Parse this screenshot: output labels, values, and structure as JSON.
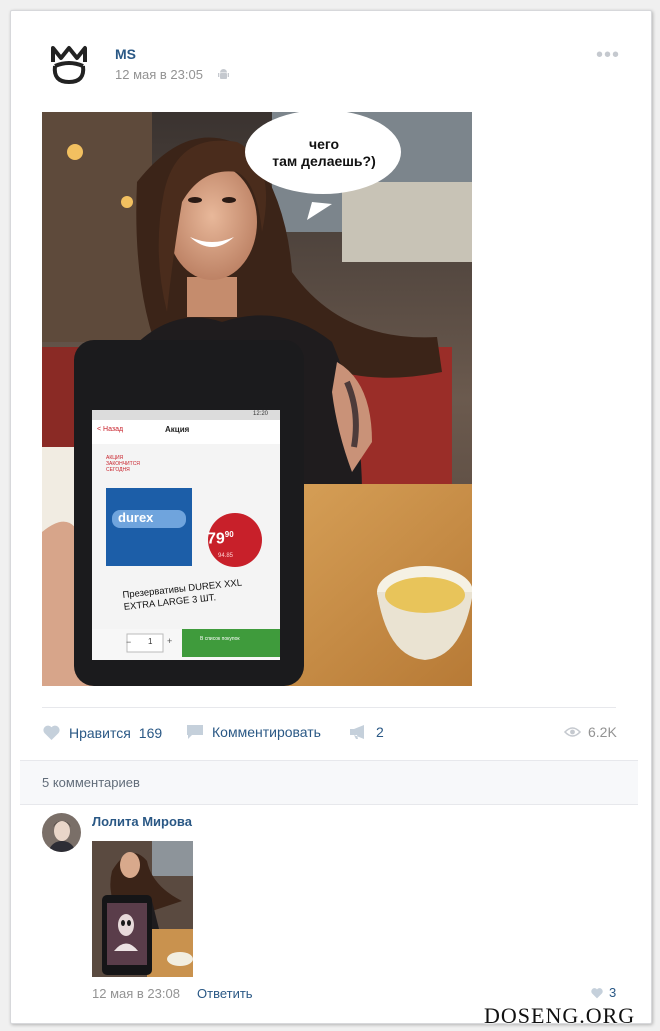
{
  "post": {
    "author": "MS",
    "date": "12 мая в 23:05",
    "bubble_line1": "чего",
    "bubble_line2": "там делаешь?)",
    "phone": {
      "time": "12:20",
      "back": "< Назад",
      "title": "Акция",
      "promo_small": "АКЦИЯ ЗАКОНЧИТСЯ СЕГОДНЯ",
      "brand": "durex",
      "price_main": "79",
      "price_cents": "90",
      "price_old": "94.85",
      "product_line1": "Презервативы DUREX XXL",
      "product_line2": "EXTRA LARGE 3 ШТ.",
      "qty": "1",
      "minus": "−",
      "plus": "+",
      "list_btn": "В список покупок"
    }
  },
  "actions": {
    "like_label": "Нравится",
    "like_count": "169",
    "comment_label": "Комментировать",
    "share_count": "2",
    "views": "6.2K"
  },
  "comments": {
    "count_label": "5 комментариев",
    "first": {
      "author": "Лолита Мирова",
      "date": "12 мая в 23:08",
      "reply_label": "Ответить",
      "likes": "3"
    }
  },
  "watermark": "DOSENG.ORG",
  "colors": {
    "link": "#2a5885",
    "muted": "#939393",
    "icon": "#c5c9cf"
  }
}
